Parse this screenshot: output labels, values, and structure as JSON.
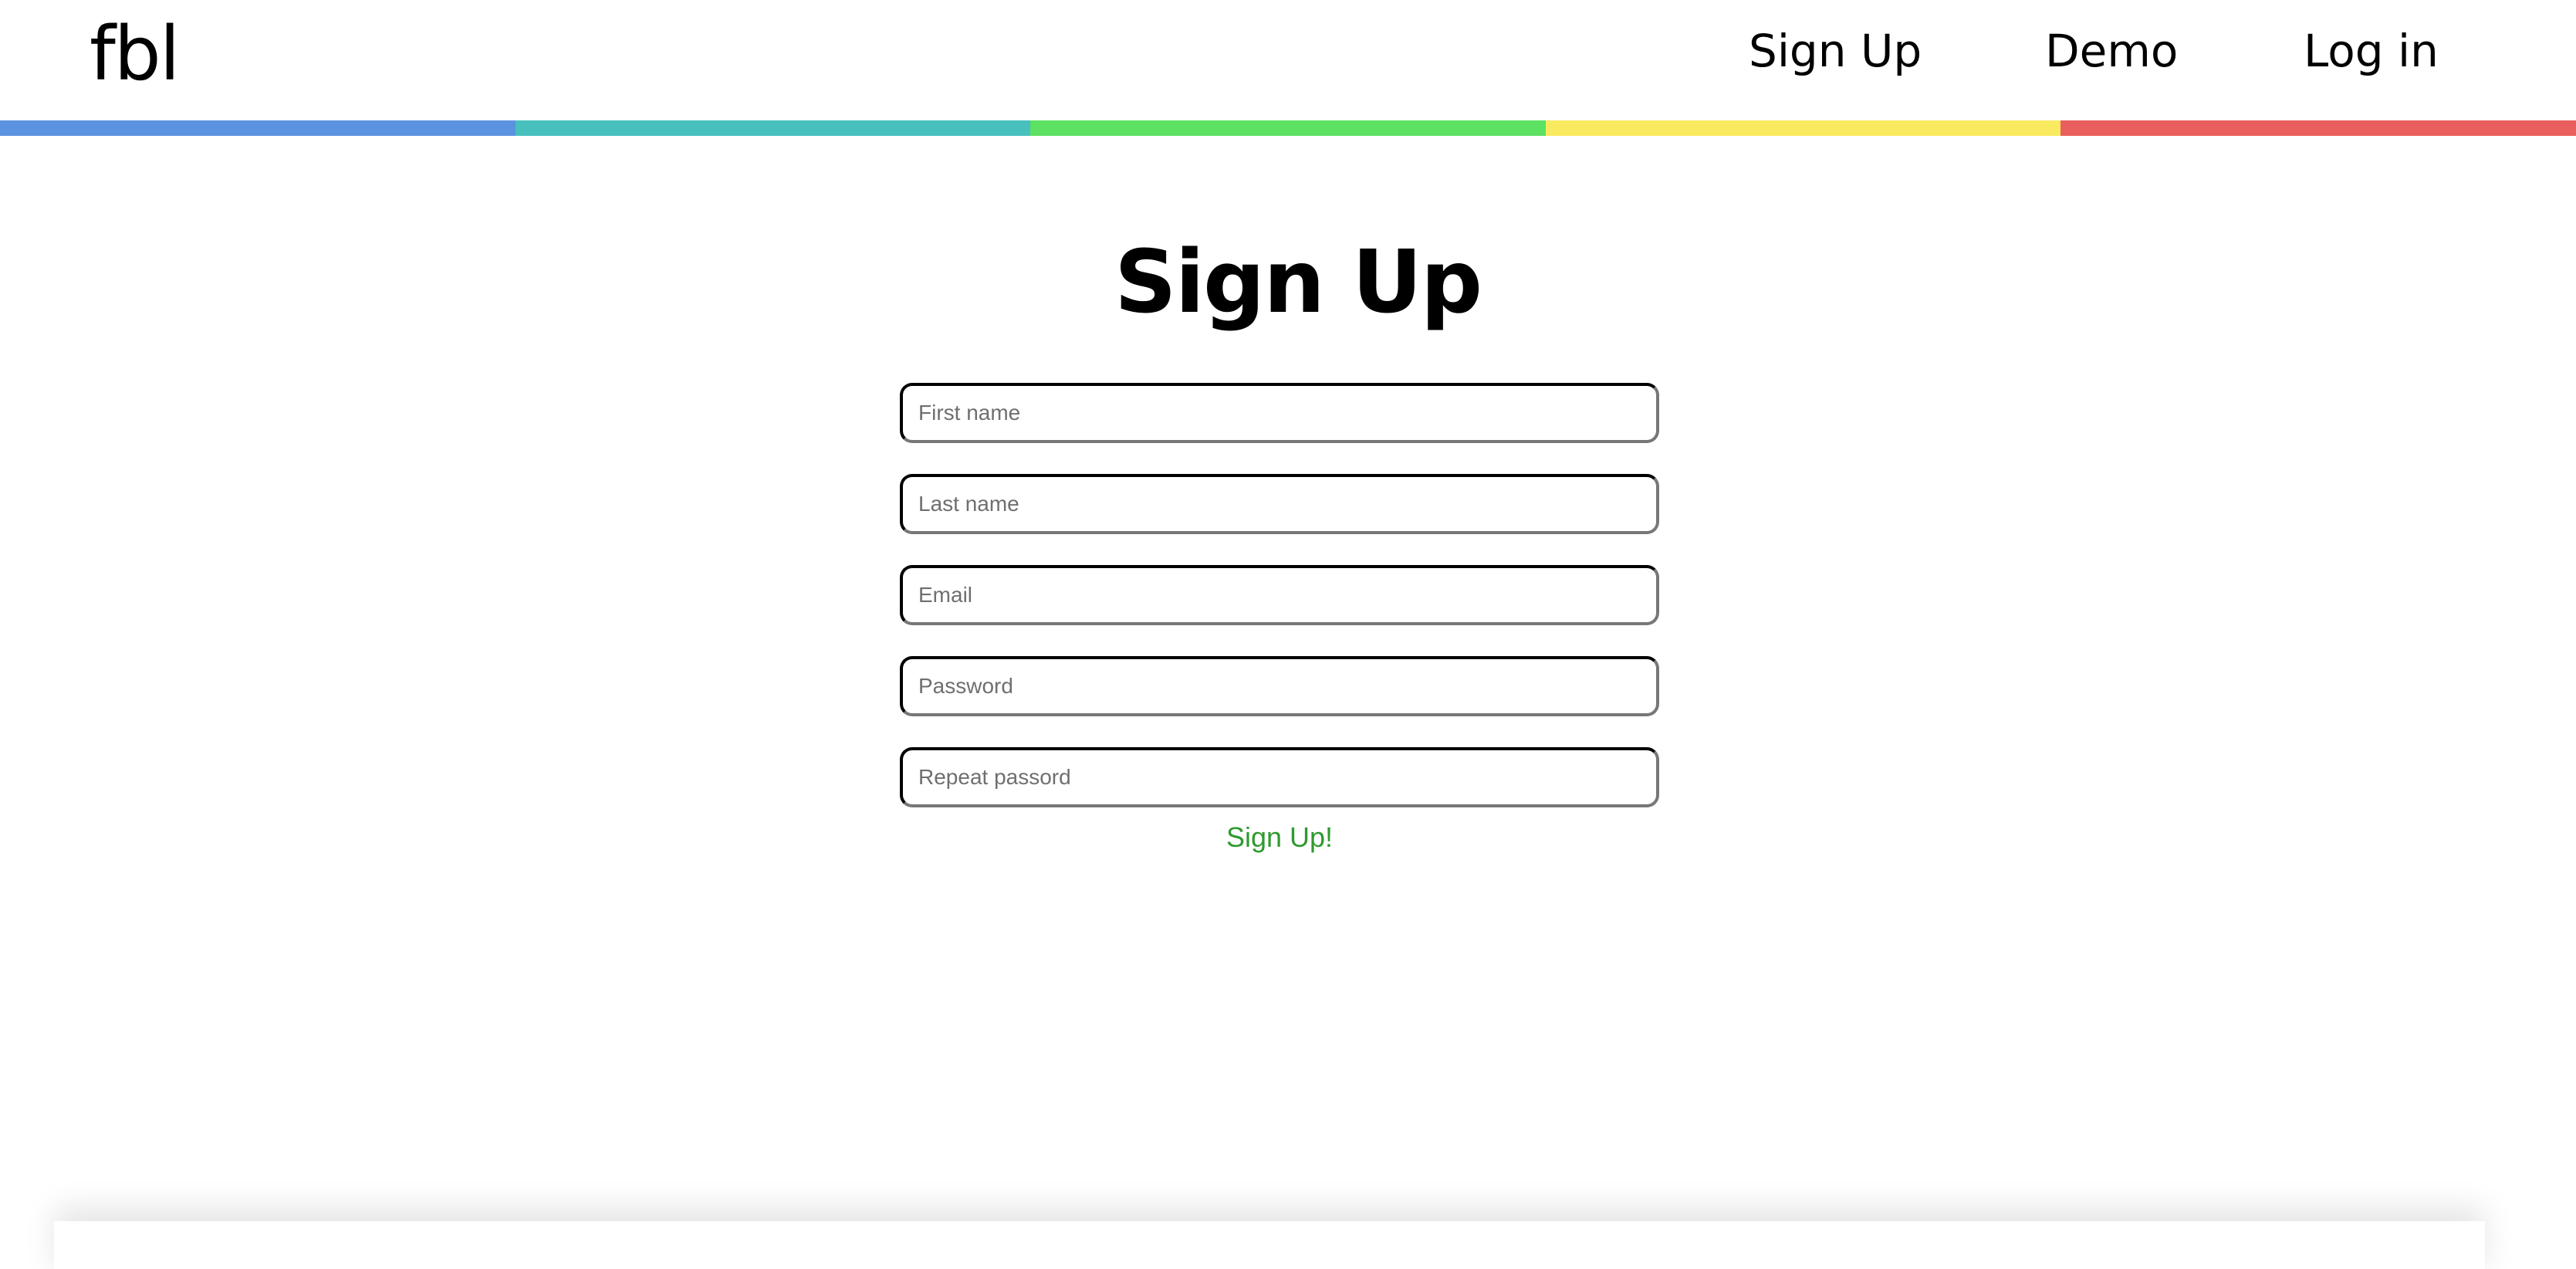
{
  "header": {
    "logo": "fbl",
    "nav": {
      "signup": "Sign Up",
      "demo": "Demo",
      "login": "Log in"
    },
    "rainbow_colors": [
      "#5b93e0",
      "#47c0be",
      "#5ce163",
      "#f9ea60",
      "#eb5e5e"
    ]
  },
  "main": {
    "title": "Sign Up",
    "title_underline_colors": [
      "#9bd42c",
      "#f6bb2f"
    ],
    "form": {
      "first_name_placeholder": "First name",
      "last_name_placeholder": "Last name",
      "email_placeholder": "Email",
      "password_placeholder": "Password",
      "repeat_password_placeholder": "Repeat passord",
      "submit_label": "Sign Up!",
      "submit_color": "#2e9a2e"
    }
  }
}
